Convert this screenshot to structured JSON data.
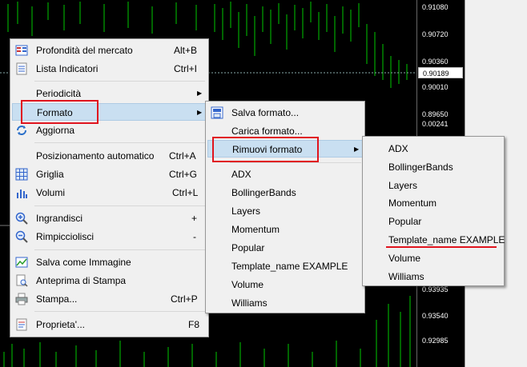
{
  "price_scale": [
    "0.91080",
    "0.90720",
    "0.90360",
    "0.90189",
    "0.90010",
    "0.89650",
    "0.00241",
    "0.93935",
    "0.93540",
    "0.92985"
  ],
  "price_box": "0.90189",
  "main_menu": {
    "items": [
      {
        "label": "Profondità del mercato",
        "shortcut": "Alt+B",
        "icon": "market-depth-icon"
      },
      {
        "label": "Lista Indicatori",
        "shortcut": "Ctrl+I",
        "icon": "indicators-list-icon"
      },
      {
        "label": "Periodicità",
        "shortcut": "",
        "submenu": true
      },
      {
        "label": "Formato",
        "shortcut": "",
        "submenu": true
      },
      {
        "label": "Aggiorna",
        "shortcut": "",
        "icon": "refresh-icon"
      },
      {
        "label": "Posizionamento automatico",
        "shortcut": "Ctrl+A"
      },
      {
        "label": "Griglia",
        "shortcut": "Ctrl+G",
        "icon": "grid-icon"
      },
      {
        "label": "Volumi",
        "shortcut": "Ctrl+L",
        "icon": "volumes-icon"
      },
      {
        "label": "Ingrandisci",
        "shortcut": "+",
        "icon": "zoom-in-icon"
      },
      {
        "label": "Rimpicciolisci",
        "shortcut": "-",
        "icon": "zoom-out-icon"
      },
      {
        "label": "Salva come Immagine",
        "shortcut": "",
        "icon": "save-image-icon"
      },
      {
        "label": "Anteprima di Stampa",
        "shortcut": "",
        "icon": "print-preview-icon"
      },
      {
        "label": "Stampa...",
        "shortcut": "Ctrl+P",
        "icon": "print-icon"
      },
      {
        "label": "Proprieta'...",
        "shortcut": "F8",
        "icon": "properties-icon"
      }
    ]
  },
  "format_menu": {
    "items": [
      {
        "label": "Salva formato...",
        "icon": "save-format-icon"
      },
      {
        "label": "Carica formato..."
      },
      {
        "label": "Rimuovi formato",
        "submenu": true
      },
      {
        "label": "ADX"
      },
      {
        "label": "BollingerBands"
      },
      {
        "label": "Layers"
      },
      {
        "label": "Momentum"
      },
      {
        "label": "Popular"
      },
      {
        "label": "Template_name EXAMPLE"
      },
      {
        "label": "Volume"
      },
      {
        "label": "Williams"
      }
    ]
  },
  "remove_menu": {
    "items": [
      {
        "label": "ADX"
      },
      {
        "label": "BollingerBands"
      },
      {
        "label": "Layers"
      },
      {
        "label": "Momentum"
      },
      {
        "label": "Popular"
      },
      {
        "label": "Template_name EXAMPLE"
      },
      {
        "label": "Volume"
      },
      {
        "label": "Williams"
      }
    ]
  },
  "colors": {
    "highlight": "#c9dff1",
    "annotation_red": "#e0141e",
    "candles": "#00c800"
  }
}
